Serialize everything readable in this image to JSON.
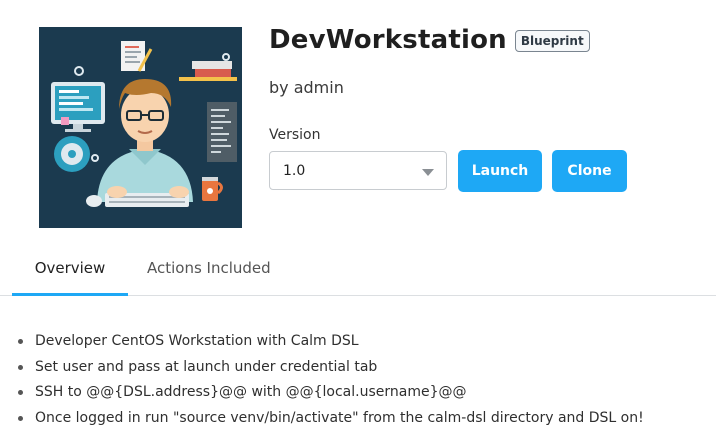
{
  "blueprint": {
    "title": "DevWorkstation",
    "badge": "Blueprint",
    "author": "by admin",
    "version_label": "Version",
    "version_value": "1.0"
  },
  "buttons": {
    "launch": "Launch",
    "clone": "Clone"
  },
  "tabs": [
    {
      "label": "Overview",
      "active": true
    },
    {
      "label": "Actions Included",
      "active": false
    }
  ],
  "description": [
    "Developer CentOS Workstation with Calm DSL",
    "Set user and pass at launch under credential tab",
    "SSH to @@{DSL.address}@@ with @@{local.username}@@",
    "Once logged in run \"source venv/bin/activate\" from the calm-dsl directory and DSL on!"
  ],
  "colors": {
    "accent": "#1ea8f5",
    "illustration_bg": "#1b3a4f"
  }
}
